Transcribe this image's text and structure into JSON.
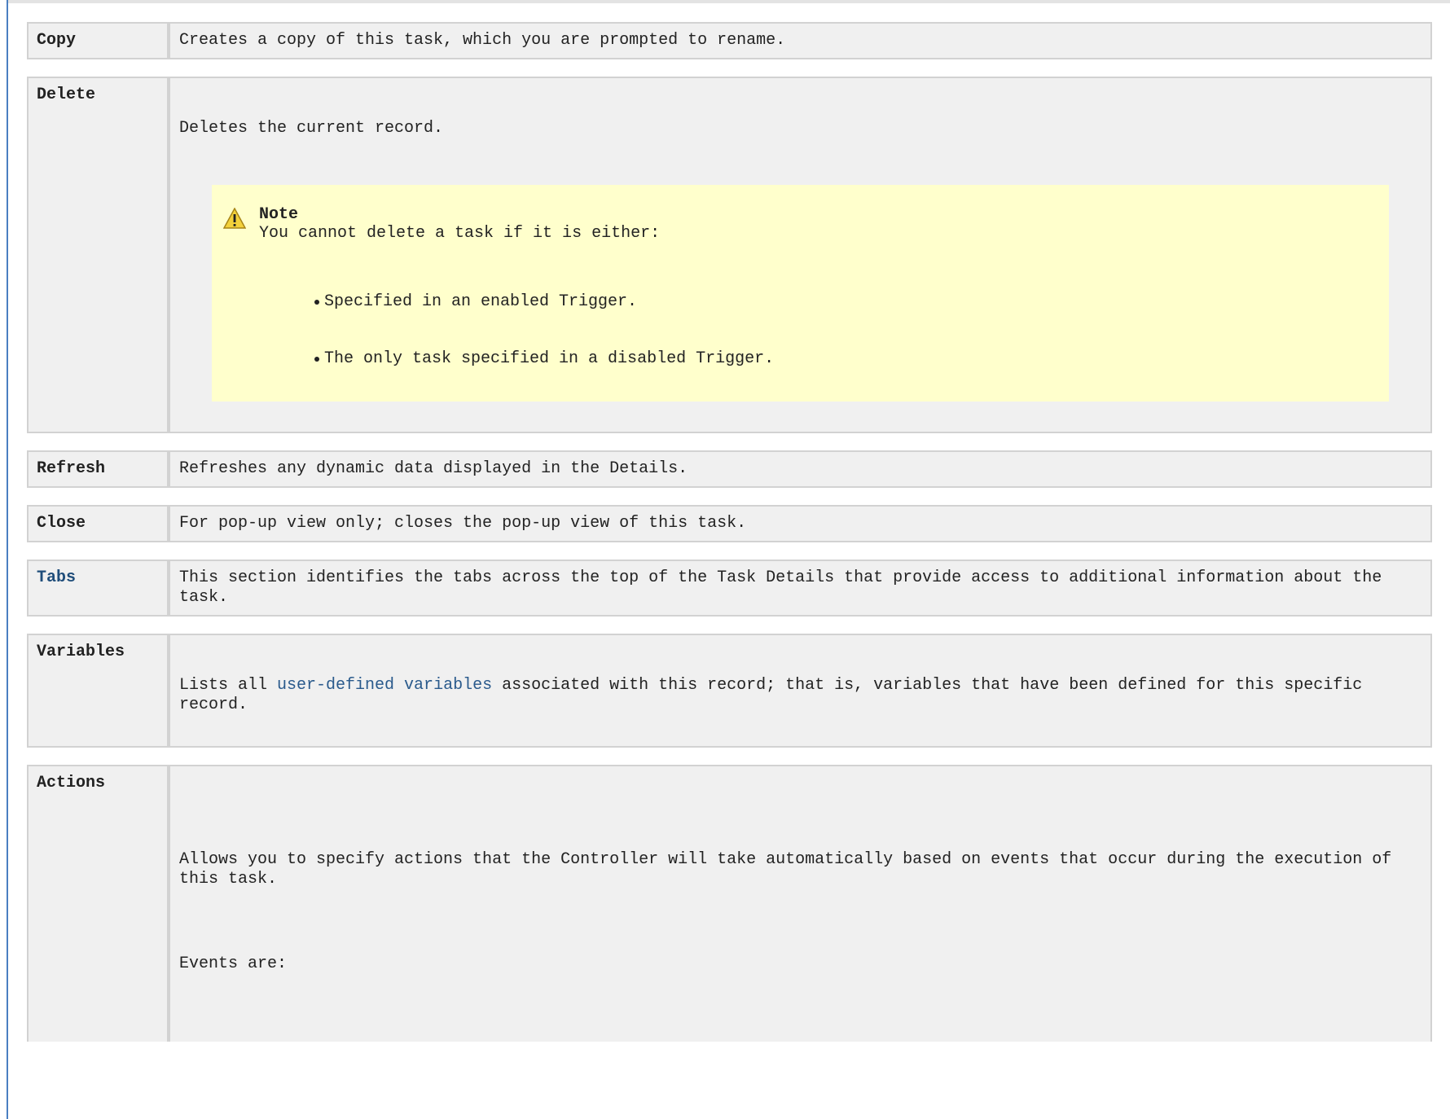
{
  "rows": [
    {
      "term": "Copy",
      "desc": "Creates a copy of this task, which you are prompted to rename."
    },
    {
      "term": "Delete",
      "desc": "Deletes the current record.",
      "note": {
        "title": "Note",
        "text": "You cannot delete a task if it is either:",
        "items": [
          "Specified in an enabled Trigger.",
          "The only task specified in a disabled Trigger."
        ]
      }
    },
    {
      "term": "Refresh",
      "desc": "Refreshes any dynamic data displayed in the Details."
    },
    {
      "term": "Close",
      "desc": "For pop-up view only; closes the pop-up view of this task."
    },
    {
      "term": "Tabs",
      "desc": "This section identifies the tabs across the top of the Task Details that provide access to additional information about the task."
    },
    {
      "term": "Variables",
      "desc_pre": "Lists all ",
      "desc_link": "user-defined variables",
      "desc_post": " associated with this record; that is, variables that have been defined for this specific record."
    },
    {
      "term": "Actions",
      "desc": "Allows you to specify actions that the Controller will take automatically based on events that occur during the execution of this task.",
      "desc2": "Events are:"
    }
  ],
  "colors": {
    "row_bg": "#f0f0f0",
    "border": "#d2d2d2",
    "note_bg": "#ffffcc",
    "link": "#2a5a8c",
    "left_rule": "#4a7fc1"
  },
  "icons": {
    "note": "warning-icon"
  }
}
